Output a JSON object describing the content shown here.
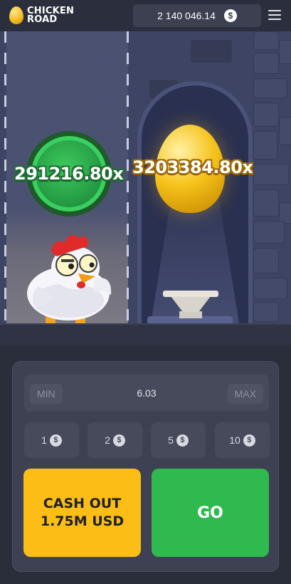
{
  "header": {
    "logo_line1": "CHICKEN",
    "logo_line2": "ROAD",
    "balance": "2 140 046.14",
    "currency_symbol": "$"
  },
  "scene": {
    "lane_multiplier": "291216.80x",
    "egg_multiplier": "3203384.80x"
  },
  "controls": {
    "min_label": "MIN",
    "max_label": "MAX",
    "bet_amount": "6.03",
    "quick_bets": [
      {
        "label": "1"
      },
      {
        "label": "2"
      },
      {
        "label": "5"
      },
      {
        "label": "10"
      }
    ],
    "cash_out_line1": "CASH OUT",
    "cash_out_line2": "1.75M USD",
    "go_label": "GO"
  },
  "colors": {
    "go_button": "#2fb94f",
    "cash_out_button": "#fbbd16",
    "panel": "#3d4152"
  }
}
